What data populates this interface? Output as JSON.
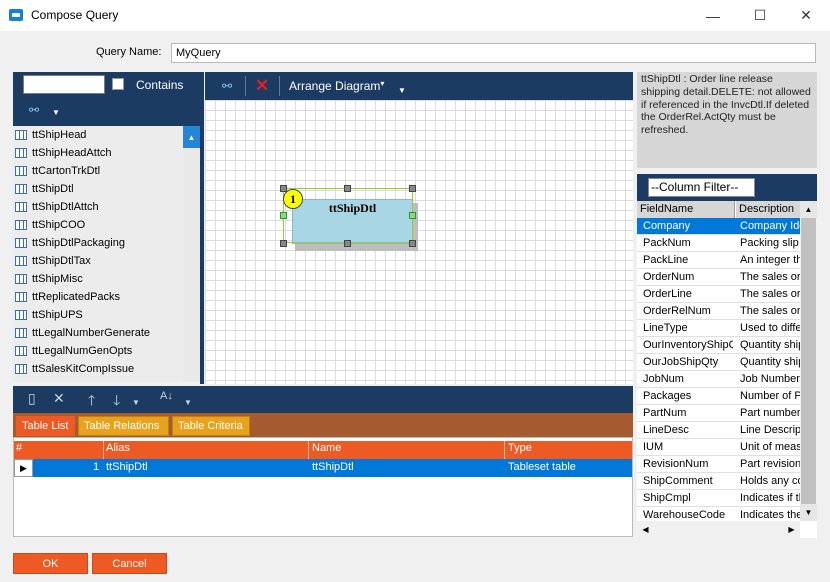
{
  "window": {
    "title": "Compose Query",
    "minimize_glyph": "—",
    "maximize_glyph": "☐",
    "close_glyph": "✕"
  },
  "query_name": {
    "label": "Query Name:",
    "value": "MyQuery"
  },
  "table_search": {
    "value": "",
    "contains_label": "Contains",
    "contains_checked": false
  },
  "tables": [
    "ttShipHead",
    "ttShipHeadAttch",
    "ttCartonTrkDtl",
    "ttShipDtl",
    "ttShipDtlAttch",
    "ttShipCOO",
    "ttShipDtlPackaging",
    "ttShipDtlTax",
    "ttShipMisc",
    "ttReplicatedPacks",
    "ttShipUPS",
    "ttLegalNumberGenerate",
    "ttLegalNumGenOpts",
    "ttSalesKitCompIssue"
  ],
  "diagram": {
    "arrange_label": "Arrange Diagram",
    "table_name": "ttShipDtl",
    "badge": "1"
  },
  "description": "ttShipDtl : Order line release shipping detail.DELETE: not allowed if referenced in the InvcDtl.If deleted the OrderRel.ActQty must be refreshed.",
  "column_filter": {
    "placeholder": "--Column Filter--"
  },
  "columns_header": {
    "field": "FieldName",
    "desc": "Description"
  },
  "columns": [
    {
      "field": "Company",
      "desc": "Company Identifier"
    },
    {
      "field": "PackNum",
      "desc": "Packing slip"
    },
    {
      "field": "PackLine",
      "desc": "An integer that"
    },
    {
      "field": "OrderNum",
      "desc": "The sales order"
    },
    {
      "field": "OrderLine",
      "desc": "The sales order"
    },
    {
      "field": "OrderRelNum",
      "desc": "The sales order"
    },
    {
      "field": "LineType",
      "desc": "Used to differentiate"
    },
    {
      "field": "OurInventoryShipQty",
      "desc": "Quantity shipped"
    },
    {
      "field": "OurJobShipQty",
      "desc": "Quantity shipped"
    },
    {
      "field": "JobNum",
      "desc": "Job Number"
    },
    {
      "field": "Packages",
      "desc": "Number of Packages"
    },
    {
      "field": "PartNum",
      "desc": "Part number"
    },
    {
      "field": "LineDesc",
      "desc": "Line Description"
    },
    {
      "field": "IUM",
      "desc": "Unit of measure"
    },
    {
      "field": "RevisionNum",
      "desc": "Part revision"
    },
    {
      "field": "ShipComment",
      "desc": "Holds any comments"
    },
    {
      "field": "ShipCmpl",
      "desc": "Indicates if the"
    },
    {
      "field": "WarehouseCode",
      "desc": "Indicates the"
    }
  ],
  "tabs": [
    {
      "label": "Table List",
      "active": true
    },
    {
      "label": "Table Relations",
      "active": false
    },
    {
      "label": "Table Criteria",
      "active": false
    }
  ],
  "table_grid": {
    "headers": {
      "num": "#",
      "alias": "Alias",
      "name": "Name",
      "type": "Type"
    },
    "rows": [
      {
        "num": "1",
        "alias": "ttShipDtl",
        "name": "ttShipDtl",
        "type": "Tableset table"
      }
    ]
  },
  "buttons": {
    "ok": "OK",
    "cancel": "Cancel"
  },
  "colors": {
    "navy": "#1c3b63",
    "accent": "#ee5a24",
    "tab_inactive": "#e8a21b",
    "selection": "#0078d7"
  }
}
